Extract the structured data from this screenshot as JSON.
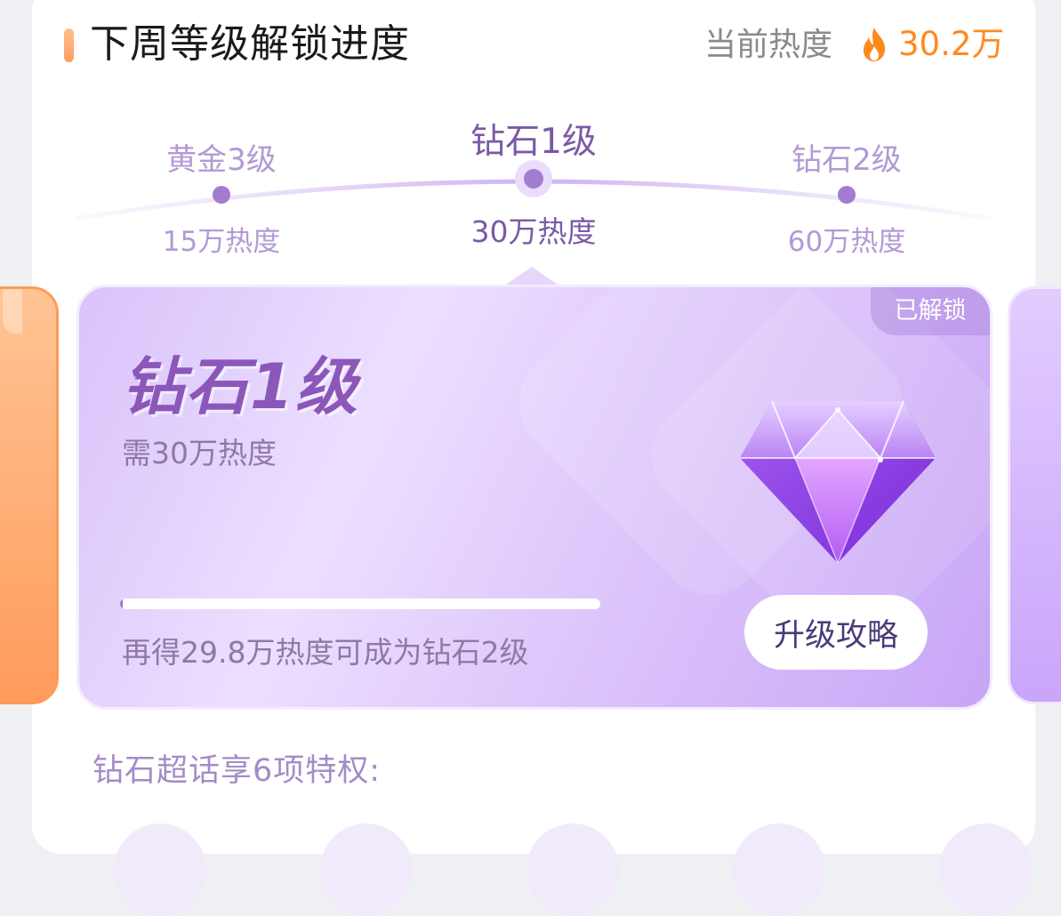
{
  "header": {
    "title": "下周等级解锁进度",
    "heat_label": "当前热度",
    "heat_value": "30.2万",
    "accent_color": "#ff8a1f",
    "icon": "fire-icon"
  },
  "timeline": {
    "current_index": 1,
    "levels": [
      {
        "name": "黄金3级",
        "heat": "15万热度"
      },
      {
        "name": "钻石1级",
        "heat": "30万热度"
      },
      {
        "name": "钻石2级",
        "heat": "60万热度"
      }
    ]
  },
  "card": {
    "badge": "已解锁",
    "title": "钻石1级",
    "requirement": "需30万热度",
    "progress_fraction": 0.005,
    "progress_hint": "再得29.8万热度可成为钻石2级",
    "button_label": "升级攻略",
    "icon": "diamond-icon",
    "colors": {
      "primary": "#8b57b9",
      "card_light": "#ecdfff",
      "card_dark": "#c8a5f6"
    }
  },
  "privileges": {
    "title": "钻石超话享6项特权:"
  }
}
